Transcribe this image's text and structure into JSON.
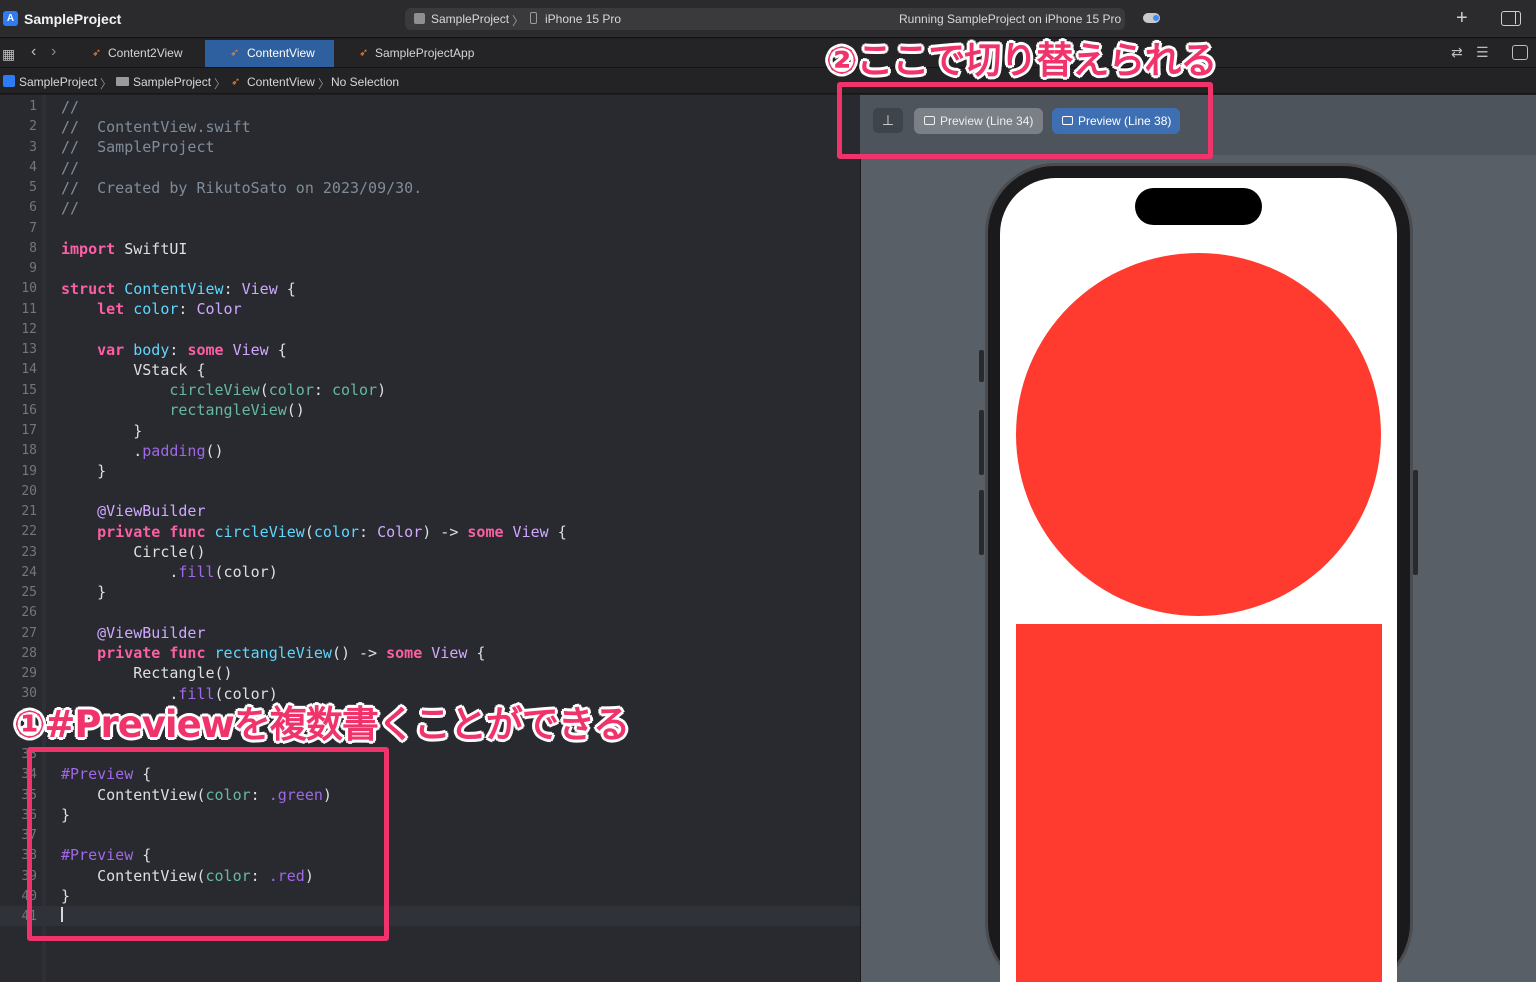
{
  "titlebar": {
    "project_name": "SampleProject",
    "scheme": "SampleProject",
    "scheme_sep": "〉",
    "device": "iPhone 15 Pro",
    "status": "Running SampleProject on iPhone 15 Pro"
  },
  "tabs": [
    {
      "label": "Content2View",
      "active": false
    },
    {
      "label": "ContentView",
      "active": true
    },
    {
      "label": "SampleProjectApp",
      "active": false
    }
  ],
  "breadcrumb": {
    "items": [
      "SampleProject",
      "SampleProject",
      "ContentView",
      "No Selection"
    ],
    "sep": "〉"
  },
  "code_lines": [
    {
      "n": "1"
    },
    {
      "n": "2"
    },
    {
      "n": "3"
    },
    {
      "n": "4"
    },
    {
      "n": "5"
    },
    {
      "n": "6"
    },
    {
      "n": "7"
    },
    {
      "n": "8"
    },
    {
      "n": "9"
    },
    {
      "n": "10"
    },
    {
      "n": "11"
    },
    {
      "n": "12"
    },
    {
      "n": "13"
    },
    {
      "n": "14"
    },
    {
      "n": "15"
    },
    {
      "n": "16"
    },
    {
      "n": "17"
    },
    {
      "n": "18"
    },
    {
      "n": "19"
    },
    {
      "n": "20"
    },
    {
      "n": "21"
    },
    {
      "n": "22"
    },
    {
      "n": "23"
    },
    {
      "n": "24"
    },
    {
      "n": "25"
    },
    {
      "n": "26"
    },
    {
      "n": "27"
    },
    {
      "n": "28"
    },
    {
      "n": "29"
    },
    {
      "n": "30"
    },
    {
      "n": "31"
    },
    {
      "n": "32"
    },
    {
      "n": "33"
    },
    {
      "n": "34"
    },
    {
      "n": "35"
    },
    {
      "n": "36"
    },
    {
      "n": "37"
    },
    {
      "n": "38"
    },
    {
      "n": "39"
    },
    {
      "n": "40"
    },
    {
      "n": "41"
    }
  ],
  "code": {
    "l1": "//",
    "l2": "//  ContentView.swift",
    "l3": "//  SampleProject",
    "l4": "//",
    "l5": "//  Created by RikutoSato on 2023/09/30.",
    "l6": "//",
    "l8_kw": "import",
    "l8_rest": " SwiftUI",
    "l10_kw": "struct",
    "l10_name": " ContentView",
    "l10_colon": ": ",
    "l10_type": "View",
    "l10_brace": " {",
    "l11_kw": "    let",
    "l11_name": " color",
    "l11_colon": ": ",
    "l11_type": "Color",
    "l13_kw": "    var",
    "l13_name": " body",
    "l13_colon": ": ",
    "l13_some": "some",
    "l13_type": " View",
    "l13_brace": " {",
    "l14": "        VStack {",
    "l15_fn": "            circleView",
    "l15_paren": "(",
    "l15_arg": "color",
    "l15_rest": ": ",
    "l15_val": "color",
    "l15_close": ")",
    "l16_fn": "            rectangleView",
    "l16_rest": "()",
    "l17": "        }",
    "l18_dot": "        .",
    "l18_mem": "padding",
    "l18_rest": "()",
    "l19": "    }",
    "l21": "    @ViewBuilder",
    "l22_kw": "    private func",
    "l22_name": " circleView",
    "l22_p1": "(",
    "l22_arg": "color",
    "l22_colon": ": ",
    "l22_type": "Color",
    "l22_arrow": ") -> ",
    "l22_some": "some",
    "l22_view": " View",
    "l22_brace": " {",
    "l23": "        Circle()",
    "l24_dot": "            .",
    "l24_mem": "fill",
    "l24_rest": "(color)",
    "l25": "    }",
    "l27": "    @ViewBuilder",
    "l28_kw": "    private func",
    "l28_name": " rectangleView",
    "l28_arrow": "() -> ",
    "l28_some": "some",
    "l28_view": " View",
    "l28_brace": " {",
    "l29": "        Rectangle()",
    "l30_dot": "            .",
    "l30_mem": "fill",
    "l30_rest": "(color)",
    "l34_kw": "#Preview",
    "l34_brace": " {",
    "l35_call": "    ContentView(",
    "l35_arg": "color",
    "l35_colon": ": ",
    "l35_val": ".green",
    "l35_close": ")",
    "l36": "}",
    "l38_kw": "#Preview",
    "l38_brace": " {",
    "l39_call": "    ContentView(",
    "l39_arg": "color",
    "l39_colon": ": ",
    "l39_val": ".red",
    "l39_close": ")",
    "l40": "}"
  },
  "preview_toolbar": {
    "pin_icon": "pin-icon",
    "buttons": [
      {
        "label": "Preview (Line 34)",
        "selected": false
      },
      {
        "label": "Preview (Line 38)",
        "selected": true
      }
    ]
  },
  "preview": {
    "device": "iPhone 15 Pro",
    "shape_color": "#ff3b30"
  },
  "annotations": {
    "note1": "①#Previewを複数書くことができる",
    "note2": "②ここで切り替えられる",
    "color": "#f0336a"
  }
}
